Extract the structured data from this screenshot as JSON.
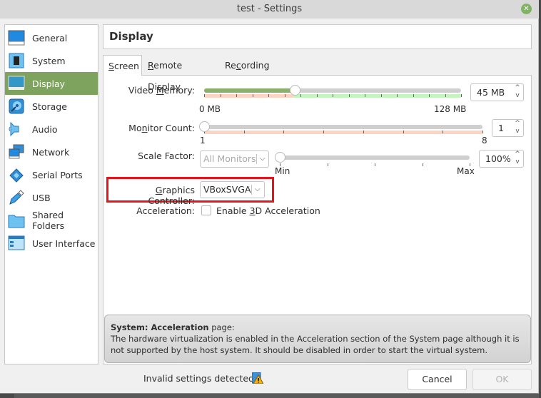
{
  "window": {
    "title": "test - Settings",
    "close_icon": "close-icon"
  },
  "sidebar": {
    "items": [
      {
        "label": "General",
        "icon": "general-monitor-icon",
        "selected": false
      },
      {
        "label": "System",
        "icon": "system-chip-icon",
        "selected": false
      },
      {
        "label": "Display",
        "icon": "display-monitor-icon",
        "selected": true
      },
      {
        "label": "Storage",
        "icon": "storage-disk-icon",
        "selected": false
      },
      {
        "label": "Audio",
        "icon": "audio-speaker-icon",
        "selected": false
      },
      {
        "label": "Network",
        "icon": "network-icon",
        "selected": false
      },
      {
        "label": "Serial Ports",
        "icon": "serial-port-icon",
        "selected": false
      },
      {
        "label": "USB",
        "icon": "usb-icon",
        "selected": false
      },
      {
        "label": "Shared Folders",
        "icon": "folder-icon",
        "selected": false
      },
      {
        "label": "User Interface",
        "icon": "user-interface-icon",
        "selected": false
      }
    ]
  },
  "page": {
    "title": "Display"
  },
  "tabs": [
    {
      "label_mn": "S",
      "label_rest": "creen",
      "active": true
    },
    {
      "label_mn": "R",
      "label_rest": "emote Display",
      "active": false
    },
    {
      "label_pre": "Re",
      "label_mn": "c",
      "label_rest": "ording",
      "active": false
    }
  ],
  "screen": {
    "video_memory": {
      "label_pre": "Video ",
      "label_mn": "M",
      "label_rest": "emory:",
      "value": "45 MB",
      "min_label": "0 MB",
      "max_label": "128 MB",
      "position": 0.352
    },
    "monitor_count": {
      "label_pre": "Mo",
      "label_mn": "n",
      "label_rest": "itor Count:",
      "value": "1",
      "min_label": "1",
      "max_label": "8",
      "position": 0.0
    },
    "scale_factor": {
      "label": "Scale Factor:",
      "monitor_select": "All Monitors",
      "value": "100%",
      "min_label": "Min",
      "max_label": "Max",
      "position": 0.0
    },
    "graphics_controller": {
      "label_mn": "G",
      "label_rest": "raphics Controller:",
      "value": "VBoxSVGA"
    },
    "acceleration": {
      "label": "Acceleration:",
      "checkbox_pre": "Enable ",
      "checkbox_mn": "3",
      "checkbox_rest": "D Acceleration",
      "checked": false
    }
  },
  "message": {
    "title_bold": "System: Acceleration",
    "title_rest": " page:",
    "body": "The hardware virtualization is enabled in the Acceleration section of the System page although it is not supported by the host system. It should be disabled in order to start the virtual system."
  },
  "footer": {
    "status": "Invalid settings detected",
    "status_icon": "warning-icon",
    "cancel_label": "Cancel",
    "ok_label": "OK"
  },
  "colors": {
    "selected_bg": "#7ea35f",
    "highlight_border": "#e8141b",
    "slider_fill": "#8caf6c"
  }
}
